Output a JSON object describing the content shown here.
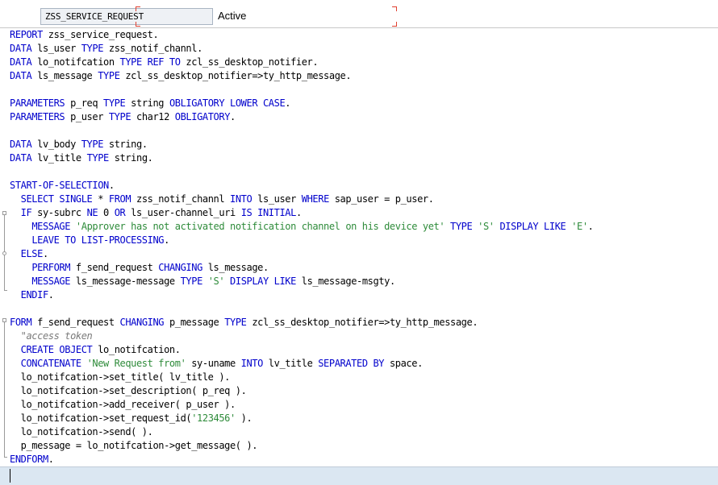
{
  "header": {
    "program_name": "ZSS_SERVICE_REQUEST",
    "status": "Active"
  },
  "colors": {
    "keyword": "#0000cc",
    "string": "#2e8b3a",
    "comment": "#7a7a7a",
    "text": "#000000",
    "cursor_line": "#dbe7f2"
  },
  "code": {
    "lines": [
      [
        [
          "kw",
          "REPORT"
        ],
        [
          "pl",
          " zss_service_request."
        ]
      ],
      [
        [
          "kw",
          "DATA"
        ],
        [
          "pl",
          " ls_user "
        ],
        [
          "kw",
          "TYPE"
        ],
        [
          "pl",
          " zss_notif_channl."
        ]
      ],
      [
        [
          "kw",
          "DATA"
        ],
        [
          "pl",
          " lo_notifcation "
        ],
        [
          "kw",
          "TYPE REF TO"
        ],
        [
          "pl",
          " zcl_ss_desktop_notifier."
        ]
      ],
      [
        [
          "kw",
          "DATA"
        ],
        [
          "pl",
          " ls_message "
        ],
        [
          "kw",
          "TYPE"
        ],
        [
          "pl",
          " zcl_ss_desktop_notifier=>ty_http_message."
        ]
      ],
      [],
      [
        [
          "kw",
          "PARAMETERS"
        ],
        [
          "pl",
          " p_req "
        ],
        [
          "kw",
          "TYPE"
        ],
        [
          "pl",
          " string "
        ],
        [
          "kw",
          "OBLIGATORY LOWER CASE"
        ],
        [
          "pl",
          "."
        ]
      ],
      [
        [
          "kw",
          "PARAMETERS"
        ],
        [
          "pl",
          " p_user "
        ],
        [
          "kw",
          "TYPE"
        ],
        [
          "pl",
          " char12 "
        ],
        [
          "kw",
          "OBLIGATORY"
        ],
        [
          "pl",
          "."
        ]
      ],
      [],
      [
        [
          "kw",
          "DATA"
        ],
        [
          "pl",
          " lv_body "
        ],
        [
          "kw",
          "TYPE"
        ],
        [
          "pl",
          " string."
        ]
      ],
      [
        [
          "kw",
          "DATA"
        ],
        [
          "pl",
          " lv_title "
        ],
        [
          "kw",
          "TYPE"
        ],
        [
          "pl",
          " string."
        ]
      ],
      [],
      [
        [
          "kw",
          "START-OF-SELECTION"
        ],
        [
          "pl",
          "."
        ]
      ],
      [
        [
          "pl",
          "  "
        ],
        [
          "kw",
          "SELECT SINGLE"
        ],
        [
          "pl",
          " * "
        ],
        [
          "kw",
          "FROM"
        ],
        [
          "pl",
          " zss_notif_channl "
        ],
        [
          "kw",
          "INTO"
        ],
        [
          "pl",
          " ls_user "
        ],
        [
          "kw",
          "WHERE"
        ],
        [
          "pl",
          " sap_user = p_user."
        ]
      ],
      [
        [
          "pl",
          "  "
        ],
        [
          "kw",
          "IF"
        ],
        [
          "pl",
          " sy-subrc "
        ],
        [
          "kw",
          "NE"
        ],
        [
          "pl",
          " 0 "
        ],
        [
          "kw",
          "OR"
        ],
        [
          "pl",
          " ls_user-channel_uri "
        ],
        [
          "kw",
          "IS INITIAL"
        ],
        [
          "pl",
          "."
        ]
      ],
      [
        [
          "pl",
          "    "
        ],
        [
          "kw",
          "MESSAGE"
        ],
        [
          "pl",
          " "
        ],
        [
          "str",
          "'Approver has not activated notification channel on his device yet'"
        ],
        [
          "pl",
          " "
        ],
        [
          "kw",
          "TYPE"
        ],
        [
          "pl",
          " "
        ],
        [
          "str",
          "'S'"
        ],
        [
          "pl",
          " "
        ],
        [
          "kw",
          "DISPLAY LIKE"
        ],
        [
          "pl",
          " "
        ],
        [
          "str",
          "'E'"
        ],
        [
          "pl",
          "."
        ]
      ],
      [
        [
          "pl",
          "    "
        ],
        [
          "kw",
          "LEAVE TO LIST-PROCESSING"
        ],
        [
          "pl",
          "."
        ]
      ],
      [
        [
          "pl",
          "  "
        ],
        [
          "kw",
          "ELSE"
        ],
        [
          "pl",
          "."
        ]
      ],
      [
        [
          "pl",
          "    "
        ],
        [
          "kw",
          "PERFORM"
        ],
        [
          "pl",
          " f_send_request "
        ],
        [
          "kw",
          "CHANGING"
        ],
        [
          "pl",
          " ls_message."
        ]
      ],
      [
        [
          "pl",
          "    "
        ],
        [
          "kw",
          "MESSAGE"
        ],
        [
          "pl",
          " ls_message-message "
        ],
        [
          "kw",
          "TYPE"
        ],
        [
          "pl",
          " "
        ],
        [
          "str",
          "'S'"
        ],
        [
          "pl",
          " "
        ],
        [
          "kw",
          "DISPLAY LIKE"
        ],
        [
          "pl",
          " ls_message-msgty."
        ]
      ],
      [
        [
          "pl",
          "  "
        ],
        [
          "kw",
          "ENDIF"
        ],
        [
          "pl",
          "."
        ]
      ],
      [],
      [
        [
          "kw",
          "FORM"
        ],
        [
          "pl",
          " f_send_request "
        ],
        [
          "kw",
          "CHANGING"
        ],
        [
          "pl",
          " p_message "
        ],
        [
          "kw",
          "TYPE"
        ],
        [
          "pl",
          " zcl_ss_desktop_notifier=>ty_http_message."
        ]
      ],
      [
        [
          "pl",
          "  "
        ],
        [
          "cmt",
          "\"access token"
        ]
      ],
      [
        [
          "pl",
          "  "
        ],
        [
          "kw",
          "CREATE OBJECT"
        ],
        [
          "pl",
          " lo_notifcation."
        ]
      ],
      [
        [
          "pl",
          "  "
        ],
        [
          "kw",
          "CONCATENATE"
        ],
        [
          "pl",
          " "
        ],
        [
          "str",
          "'New Request from'"
        ],
        [
          "pl",
          " sy-uname "
        ],
        [
          "kw",
          "INTO"
        ],
        [
          "pl",
          " lv_title "
        ],
        [
          "kw",
          "SEPARATED BY"
        ],
        [
          "pl",
          " space."
        ]
      ],
      [
        [
          "pl",
          "  lo_notifcation->set_title( lv_title )."
        ]
      ],
      [
        [
          "pl",
          "  lo_notifcation->set_description( p_req )."
        ]
      ],
      [
        [
          "pl",
          "  lo_notifcation->add_receiver( p_user )."
        ]
      ],
      [
        [
          "pl",
          "  lo_notifcation->set_request_id("
        ],
        [
          "str",
          "'123456'"
        ],
        [
          "pl",
          " )."
        ]
      ],
      [
        [
          "pl",
          "  lo_notifcation->send( )."
        ]
      ],
      [
        [
          "pl",
          "  p_message = lo_notifcation->get_message( )."
        ]
      ],
      [
        [
          "kw",
          "ENDFORM"
        ],
        [
          "pl",
          "."
        ]
      ]
    ]
  }
}
